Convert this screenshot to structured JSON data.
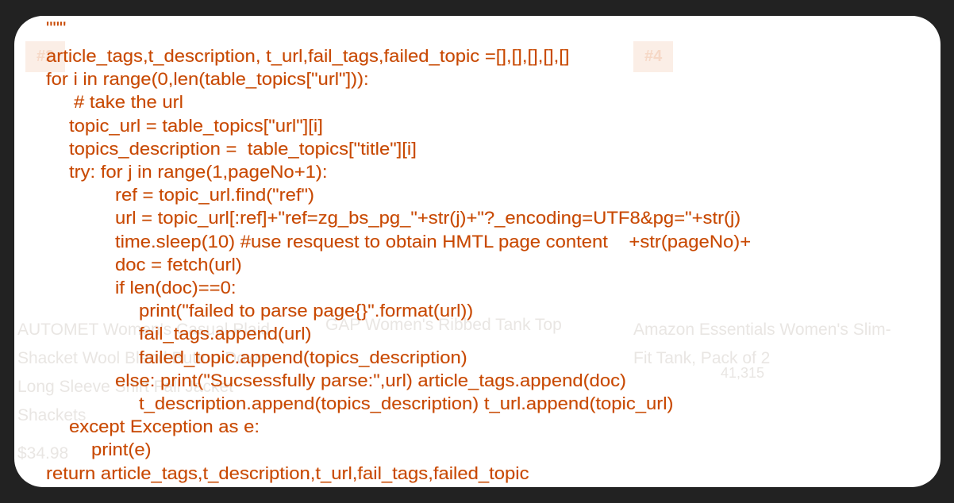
{
  "background": {
    "badges": [
      "#2",
      "#4"
    ],
    "products": [
      {
        "title_lines": [
          "AUTOMET Women's Casual Plaid",
          "Shacket Wool Blend Button Down",
          "Long Sleeve Shirt Fall Jacket",
          "Shackets"
        ],
        "price": "$34.98"
      },
      {
        "title_lines": [
          "GAP Women's Ribbed Tank Top"
        ]
      },
      {
        "title_lines": [
          "Amazon Essentials Women's Slim-",
          "Fit Tank, Pack of 2"
        ],
        "reviews": "41,315"
      }
    ]
  },
  "code_color": "#c84800",
  "code_lines": [
    {
      "indent": 0,
      "text": "\"\"\""
    },
    {
      "indent": 0,
      "text": "article_tags,t_description, t_url,fail_tags,failed_topic =[],[],[],[],[]"
    },
    {
      "indent": 0,
      "text": "for i in range(0,len(table_topics[\"url\"])):"
    },
    {
      "indent": 2,
      "text": "# take the url"
    },
    {
      "indent": 1,
      "text": "topic_url = table_topics[\"url\"][i]"
    },
    {
      "indent": 1,
      "text": "topics_description =  table_topics[\"title\"][i]"
    },
    {
      "indent": 1,
      "text": "try: for j in range(1,pageNo+1):"
    },
    {
      "indent": 3,
      "text": "ref = topic_url.find(\"ref\")"
    },
    {
      "indent": 3,
      "text": "url = topic_url[:ref]+\"ref=zg_bs_pg_\"+str(j)+\"?_encoding=UTF8&pg=\"+str(j)"
    },
    {
      "indent": 3,
      "text": "time.sleep(10) #use resquest to obtain HMTL page content    +str(pageNo)+"
    },
    {
      "indent": 3,
      "text": "doc = fetch(url)"
    },
    {
      "indent": 3,
      "text": "if len(doc)==0:"
    },
    {
      "indent": 4,
      "text": "print(\"failed to parse page{}\".format(url))"
    },
    {
      "indent": 4,
      "text": "fail_tags.append(url)"
    },
    {
      "indent": 4,
      "text": "failed_topic.append(topics_description)"
    },
    {
      "indent": 3,
      "text": "else: print(\"Sucsessfully parse:\",url) article_tags.append(doc)"
    },
    {
      "indent": 4,
      "text": "t_description.append(topics_description) t_url.append(topic_url)"
    },
    {
      "indent": 1,
      "text": "except Exception as e:"
    },
    {
      "indent": 5,
      "text": "print(e)"
    },
    {
      "indent": 0,
      "text": "return article_tags,t_description,t_url,fail_tags,failed_topic"
    }
  ]
}
